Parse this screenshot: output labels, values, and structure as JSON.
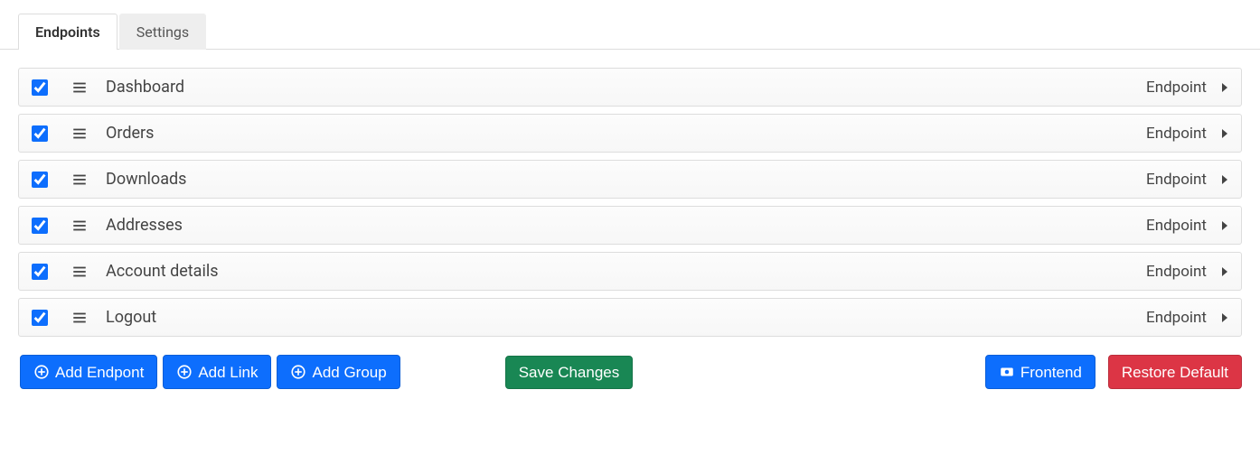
{
  "tabs": [
    {
      "label": "Endpoints",
      "active": true
    },
    {
      "label": "Settings",
      "active": false
    }
  ],
  "type_label": "Endpoint",
  "items": [
    {
      "label": "Dashboard",
      "checked": true
    },
    {
      "label": "Orders",
      "checked": true
    },
    {
      "label": "Downloads",
      "checked": true
    },
    {
      "label": "Addresses",
      "checked": true
    },
    {
      "label": "Account details",
      "checked": true
    },
    {
      "label": "Logout",
      "checked": true
    }
  ],
  "buttons": {
    "add_endpoint": "Add Endpont",
    "add_link": "Add Link",
    "add_group": "Add Group",
    "save": "Save Changes",
    "frontend": "Frontend",
    "restore": "Restore Default"
  }
}
